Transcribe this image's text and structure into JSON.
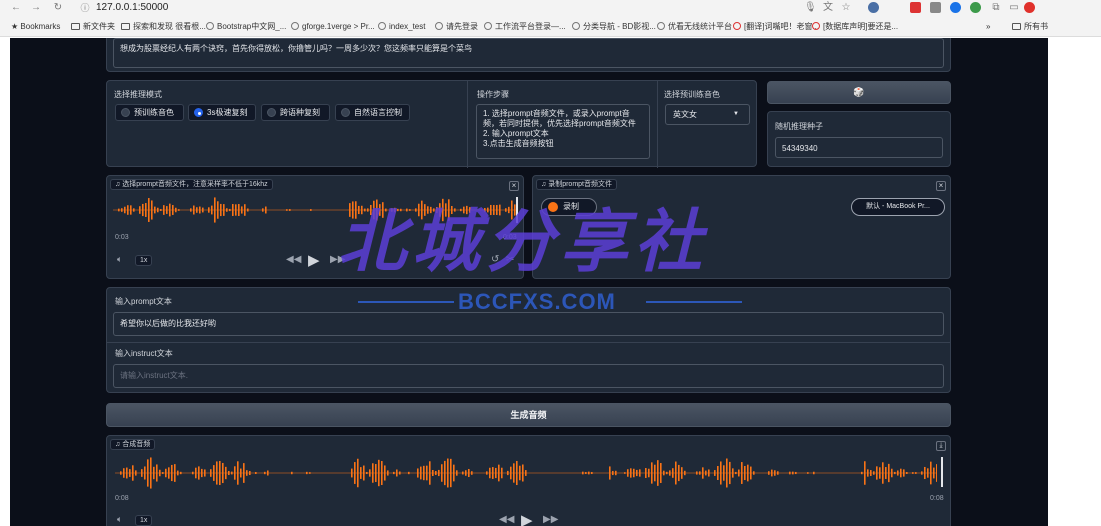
{
  "browser": {
    "url": "127.0.0.1:50000",
    "bookmarks_bar": [
      {
        "label": "Bookmarks",
        "icon": "star-icon"
      },
      {
        "label": "新文件夹",
        "icon": "folder-icon"
      },
      {
        "label": "探索和发现 很看根...",
        "icon": "folder-icon"
      },
      {
        "label": "Bootstrap中文网_...",
        "icon": "globe-icon"
      },
      {
        "label": "gforge.1verge > Pr...",
        "icon": "globe-icon"
      },
      {
        "label": "index_test",
        "icon": "globe-icon"
      },
      {
        "label": "请先登录",
        "icon": "globe-icon"
      },
      {
        "label": "工作流平台登录—...",
        "icon": "globe-icon"
      },
      {
        "label": "分类导航 - BD影视...",
        "icon": "globe-icon"
      },
      {
        "label": "优看无线统计平台",
        "icon": "globe-icon"
      },
      {
        "label": "[翻译]词嘴吧！老窗...",
        "icon": "globe-icon"
      },
      {
        "label": "[数据库声明]要还是...",
        "icon": "globe-icon"
      }
    ],
    "more_label": "»",
    "all_bookmarks_label": "所有书"
  },
  "top_textarea": {
    "value": "想成为股票经纪人有两个诀窍，首先你得放松，你撸管儿吗？一周多少次？您这频率只能算是个菜鸟"
  },
  "mode": {
    "label": "选择推理模式",
    "options": [
      "预训练音色",
      "3s极速复刻",
      "跨语种复刻",
      "自然语言控制"
    ],
    "selected": "3s极速复刻"
  },
  "steps": {
    "label": "操作步骤",
    "text_lines": [
      "1. 选择prompt音频文件，或录入prompt音",
      "频，若同时提供，优先选择prompt音频文件",
      "2. 输入prompt文本",
      "3.点击生成音频按钮"
    ]
  },
  "voice": {
    "label": "选择预训练音色",
    "selected": "英文女"
  },
  "seed": {
    "dice_label": "🎲",
    "label": "随机推理种子",
    "value": "54349340"
  },
  "upload_audio": {
    "tag": "选择prompt音频文件，注意采样率不低于16khz",
    "time_start": "0:03",
    "time_end": "0:03",
    "speed": "1x"
  },
  "record_audio": {
    "tag": "录制prompt音频文件",
    "record_label": "录制",
    "device_label": "默认 - MacBook Pr..."
  },
  "prompt_text": {
    "label": "输入prompt文本",
    "value": "希望你以后做的比我还好哟"
  },
  "instruct_text": {
    "label": "输入instruct文本",
    "placeholder": "请输入instruct文本."
  },
  "generate": {
    "label": "生成音频"
  },
  "output_audio": {
    "tag": "合成音频",
    "time_start": "0:08",
    "time_end": "0:08",
    "speed": "1x"
  },
  "watermark": {
    "main": "北城分享社",
    "sub": "BCCFXS.COM"
  },
  "colors": {
    "app_bg": "#0b0f19",
    "panel_bg": "#1f2937",
    "waveform": "#f97316",
    "radio_selected": "#2563eb",
    "watermark": "#5b3fd6"
  }
}
